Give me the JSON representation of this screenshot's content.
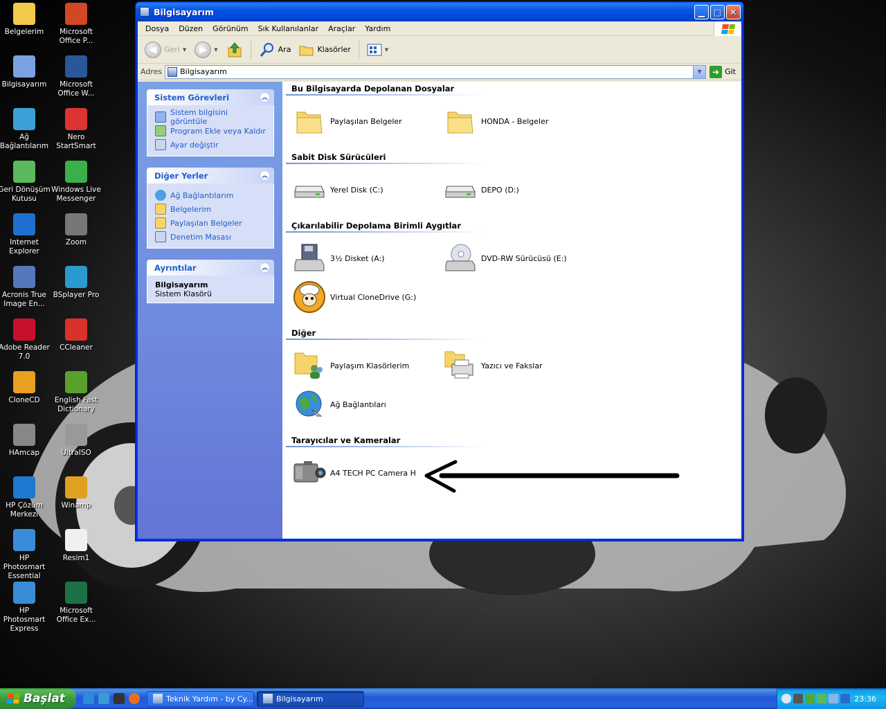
{
  "desktop": {
    "icons": [
      {
        "label": "Belgelerim",
        "color": "#f3c94a"
      },
      {
        "label": "Microsoft Office P...",
        "color": "#d24726"
      },
      {
        "label": "Bilgisayarım",
        "color": "#7aa2e0"
      },
      {
        "label": "Microsoft Office W...",
        "color": "#2b579a"
      },
      {
        "label": "Ağ Bağlantılarım",
        "color": "#3aa1d8"
      },
      {
        "label": "Nero StartSmart",
        "color": "#d33"
      },
      {
        "label": "Geri Dönüşüm Kutusu",
        "color": "#5cb85c"
      },
      {
        "label": "Windows Live Messenger",
        "color": "#3bb04a"
      },
      {
        "label": "Internet Explorer",
        "color": "#1f6fd0"
      },
      {
        "label": "Zoom",
        "color": "#777"
      },
      {
        "label": "Acronis True Image En...",
        "color": "#5577bb"
      },
      {
        "label": "BSplayer Pro",
        "color": "#2a9ad0"
      },
      {
        "label": "Adobe Reader 7.0",
        "color": "#c8102e"
      },
      {
        "label": "CCleaner",
        "color": "#d9322a"
      },
      {
        "label": "CloneCD",
        "color": "#e8a020"
      },
      {
        "label": "English Fast Dictionary",
        "color": "#5aa02c"
      },
      {
        "label": "HAmcap",
        "color": "#888"
      },
      {
        "label": "UltraISO",
        "color": "#999"
      },
      {
        "label": "HP Çözüm Merkezi",
        "color": "#1c7bd0"
      },
      {
        "label": "Winamp",
        "color": "#e0a020"
      },
      {
        "label": "HP Photosmart Essential",
        "color": "#3a8cd8"
      },
      {
        "label": "Resim1",
        "color": "#f0f0f0"
      },
      {
        "label": "HP Photosmart Express",
        "color": "#3a8cd8"
      },
      {
        "label": "Microsoft Office Ex...",
        "color": "#1e7145"
      }
    ]
  },
  "window": {
    "title": "Bilgisayarım",
    "menu": [
      "Dosya",
      "Düzen",
      "Görünüm",
      "Sık Kullanılanlar",
      "Araçlar",
      "Yardım"
    ],
    "toolbar": {
      "back": "Geri",
      "search": "Ara",
      "folders": "Klasörler"
    },
    "address": {
      "label": "Adres",
      "value": "Bilgisayarım",
      "go": "Git"
    },
    "taskpane": {
      "system_tasks": {
        "title": "Sistem Görevleri",
        "items": [
          "Sistem bilgisini görüntüle",
          "Program Ekle veya Kaldır",
          "Ayar değiştir"
        ]
      },
      "other_places": {
        "title": "Diğer Yerler",
        "items": [
          "Ağ Bağlantılarım",
          "Belgelerim",
          "Paylaşılan Belgeler",
          "Denetim Masası"
        ]
      },
      "details": {
        "title": "Ayrıntılar",
        "name": "Bilgisayarım",
        "type": "Sistem Klasörü"
      }
    },
    "groups": {
      "stored": {
        "title": "Bu Bilgisayarda Depolanan Dosyalar",
        "items": [
          "Paylaşılan Belgeler",
          "HONDA - Belgeler"
        ]
      },
      "hdd": {
        "title": "Sabit Disk Sürücüleri",
        "items": [
          "Yerel Disk (C:)",
          "DEPO (D:)"
        ]
      },
      "removable": {
        "title": "Çıkarılabilir Depolama Birimli Aygıtlar",
        "items": [
          "3½ Disket (A:)",
          "DVD-RW Sürücüsü (E:)",
          "Virtual CloneDrive (G:)"
        ]
      },
      "other": {
        "title": "Diğer",
        "items": [
          "Paylaşım Klasörlerim",
          "Yazıcı ve Fakslar",
          "Ağ Bağlantıları"
        ]
      },
      "scanners": {
        "title": "Tarayıcılar ve Kameralar",
        "items": [
          "A4 TECH PC Camera H"
        ]
      }
    }
  },
  "taskbar": {
    "start": "Başlat",
    "tasks": [
      "Teknik Yardım - by Cy...",
      "Bilgisayarım"
    ],
    "clock": "23:36"
  }
}
